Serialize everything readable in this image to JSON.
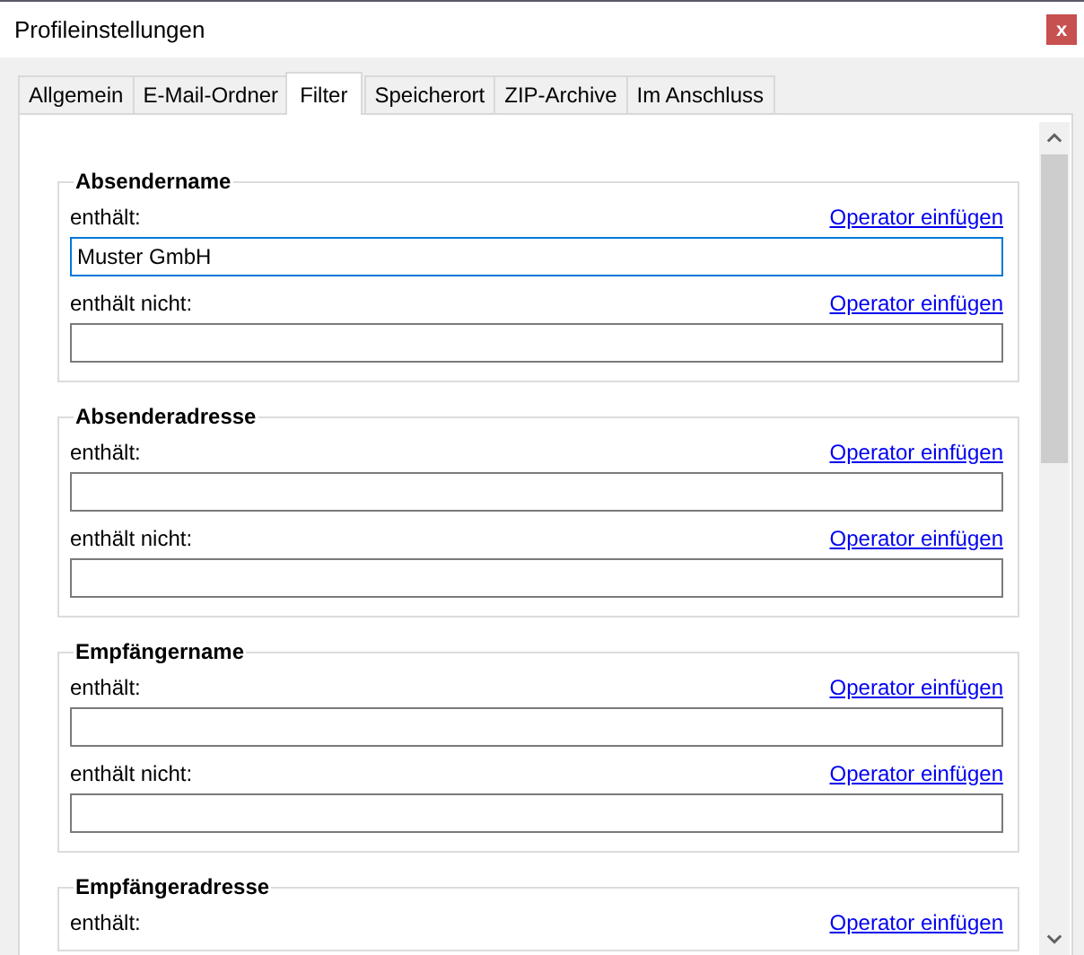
{
  "window": {
    "title": "Profileinstellungen",
    "close_label": "x"
  },
  "tabs": [
    {
      "label": "Allgemein",
      "selected": false
    },
    {
      "label": "E-Mail-Ordner",
      "selected": false
    },
    {
      "label": "Filter",
      "selected": true
    },
    {
      "label": "Speicherort",
      "selected": false
    },
    {
      "label": "ZIP-Archive",
      "selected": false
    },
    {
      "label": "Im Anschluss",
      "selected": false
    }
  ],
  "groups": [
    {
      "title": "Absendername",
      "rows": [
        {
          "label": "enthält:",
          "link": "Operator einfügen",
          "field": {
            "value": "Muster GmbH",
            "focused": true
          }
        },
        {
          "label": "enthält nicht:",
          "link": "Operator einfügen",
          "field": {
            "focused": false
          }
        }
      ]
    },
    {
      "title": "Absenderadresse",
      "rows": [
        {
          "label": "enthält:",
          "link": "Operator einfügen",
          "field": {
            "focused": false
          }
        },
        {
          "label": "enthält nicht:",
          "link": "Operator einfügen",
          "field": {
            "focused": false
          }
        }
      ]
    },
    {
      "title": "Empfängername",
      "rows": [
        {
          "label": "enthält:",
          "link": "Operator einfügen",
          "field": {
            "focused": false
          }
        },
        {
          "label": "enthält nicht:",
          "link": "Operator einfügen",
          "field": {
            "focused": false
          }
        }
      ]
    },
    {
      "title": "Empfängeradresse",
      "rows": [
        {
          "label": "enthält:",
          "link": "Operator einfügen"
        }
      ]
    }
  ]
}
